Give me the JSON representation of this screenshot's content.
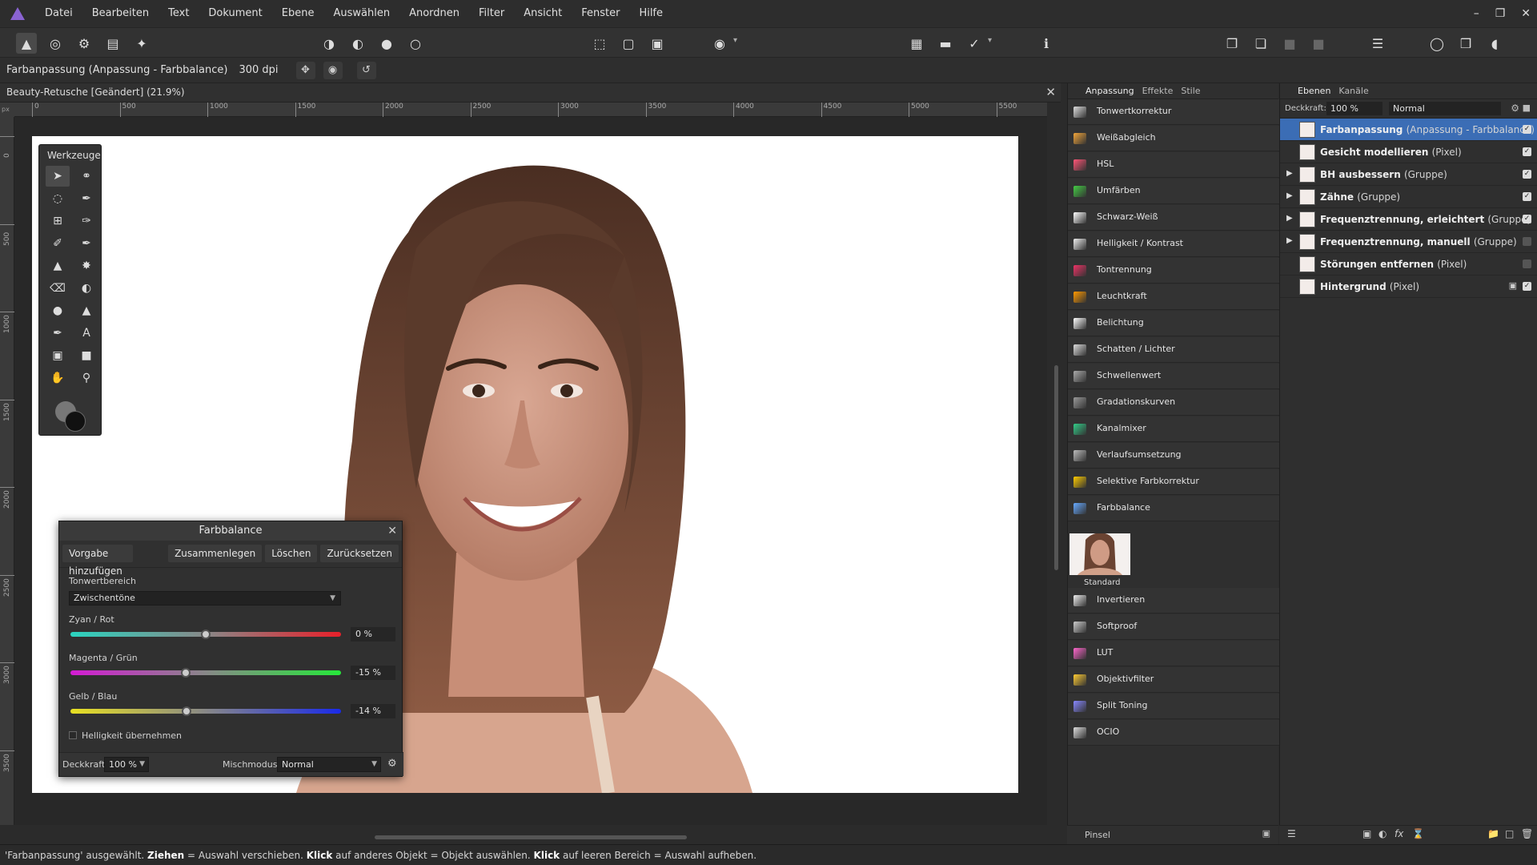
{
  "menubar": {
    "items": [
      "Datei",
      "Bearbeiten",
      "Text",
      "Dokument",
      "Ebene",
      "Auswählen",
      "Anordnen",
      "Filter",
      "Ansicht",
      "Fenster",
      "Hilfe"
    ]
  },
  "contextbar": {
    "title": "Farbanpassung (Anpassung - Farbbalance)",
    "dpi": "300 dpi"
  },
  "document": {
    "tab_title": "Beauty-Retusche [Geändert] (21.9%)",
    "ruler_unit": "px",
    "ruler_h": [
      "0",
      "500",
      "1000",
      "1500",
      "2000",
      "2500",
      "3000",
      "3500",
      "4000",
      "4500",
      "5000",
      "5500"
    ],
    "ruler_v": [
      "0",
      "500",
      "1000",
      "1500",
      "2000",
      "2500",
      "3000",
      "3500"
    ]
  },
  "tools_panel": {
    "title": "Werkzeuge"
  },
  "farbbalance": {
    "title": "Farbbalance",
    "buttons": [
      "Vorgabe hinzufügen",
      "Zusammenlegen",
      "Löschen",
      "Zurücksetzen"
    ],
    "tonal_label": "Tonwertbereich",
    "tonal_value": "Zwischentöne",
    "sliders": [
      {
        "label": "Zyan / Rot",
        "value": "0 %",
        "level": 0.5
      },
      {
        "label": "Magenta / Grün",
        "value": "-15 %",
        "level": 0.425
      },
      {
        "label": "Gelb / Blau",
        "value": "-14 %",
        "level": 0.43
      }
    ],
    "preserve_brightness": "Helligkeit übernehmen",
    "opacity_label": "Deckkraft:",
    "opacity_value": "100 %",
    "blend_label": "Mischmodus:",
    "blend_value": "Normal"
  },
  "adjustments": {
    "tabs": [
      "Anpassung",
      "Effekte",
      "Stile"
    ],
    "items": [
      {
        "label": "Tonwertkorrektur",
        "icon": "levels-icon"
      },
      {
        "label": "Weißabgleich",
        "icon": "white-balance-icon"
      },
      {
        "label": "HSL",
        "icon": "hsl-icon"
      },
      {
        "label": "Umfärben",
        "icon": "recolor-icon"
      },
      {
        "label": "Schwarz-Weiß",
        "icon": "black-white-icon"
      },
      {
        "label": "Helligkeit / Kontrast",
        "icon": "brightness-contrast-icon"
      },
      {
        "label": "Tontrennung",
        "icon": "posterize-icon"
      },
      {
        "label": "Leuchtkraft",
        "icon": "vibrance-icon"
      },
      {
        "label": "Belichtung",
        "icon": "exposure-icon"
      },
      {
        "label": "Schatten / Lichter",
        "icon": "shadows-highlights-icon"
      },
      {
        "label": "Schwellenwert",
        "icon": "threshold-icon"
      },
      {
        "label": "Gradationskurven",
        "icon": "curves-icon"
      },
      {
        "label": "Kanalmixer",
        "icon": "channel-mixer-icon"
      },
      {
        "label": "Verlaufsumsetzung",
        "icon": "gradient-map-icon"
      },
      {
        "label": "Selektive Farbkorrektur",
        "icon": "selective-color-icon"
      },
      {
        "label": "Farbbalance",
        "icon": "color-balance-icon"
      }
    ],
    "preset_label": "Standard",
    "items_after": [
      {
        "label": "Invertieren",
        "icon": "invert-icon"
      },
      {
        "label": "Softproof",
        "icon": "softproof-icon"
      },
      {
        "label": "LUT",
        "icon": "lut-icon"
      },
      {
        "label": "Objektivfilter",
        "icon": "lens-filter-icon"
      },
      {
        "label": "Split Toning",
        "icon": "split-toning-icon"
      },
      {
        "label": "OCIO",
        "icon": "ocio-icon"
      }
    ],
    "brush_label": "Pinsel"
  },
  "layers": {
    "tabs": [
      "Ebenen",
      "Kanäle"
    ],
    "opacity_label": "Deckkraft:",
    "opacity_value": "100 %",
    "blend_value": "Normal",
    "rows": [
      {
        "name": "Farbanpassung",
        "type": "(Anpassung - Farbbalance)",
        "expandable": false,
        "visible": true,
        "selected": true
      },
      {
        "name": "Gesicht modellieren",
        "type": "(Pixel)",
        "expandable": false,
        "visible": true
      },
      {
        "name": "BH ausbessern",
        "type": "(Gruppe)",
        "expandable": true,
        "visible": true
      },
      {
        "name": "Zähne",
        "type": "(Gruppe)",
        "expandable": true,
        "visible": true
      },
      {
        "name": "Frequenztrennung, erleichtert",
        "type": "(Gruppe)",
        "expandable": true,
        "visible": true
      },
      {
        "name": "Frequenztrennung, manuell",
        "type": "(Gruppe)",
        "expandable": true,
        "visible": false
      },
      {
        "name": "Störungen entfernen",
        "type": "(Pixel)",
        "expandable": false,
        "visible": false
      },
      {
        "name": "Hintergrund",
        "type": "(Pixel)",
        "expandable": false,
        "visible": true,
        "locked": true
      }
    ]
  },
  "statusbar": {
    "part1": "'Farbanpassung' ausgewählt. ",
    "b1": "Ziehen",
    "part2": " = Auswahl verschieben. ",
    "b2": "Klick",
    "part3": " auf anderes Objekt = Objekt auswählen. ",
    "b3": "Klick",
    "part4": " auf leeren Bereich = Auswahl aufheben."
  },
  "colors": {
    "accent": "#3b6db5",
    "logo": "#8a63d2"
  }
}
